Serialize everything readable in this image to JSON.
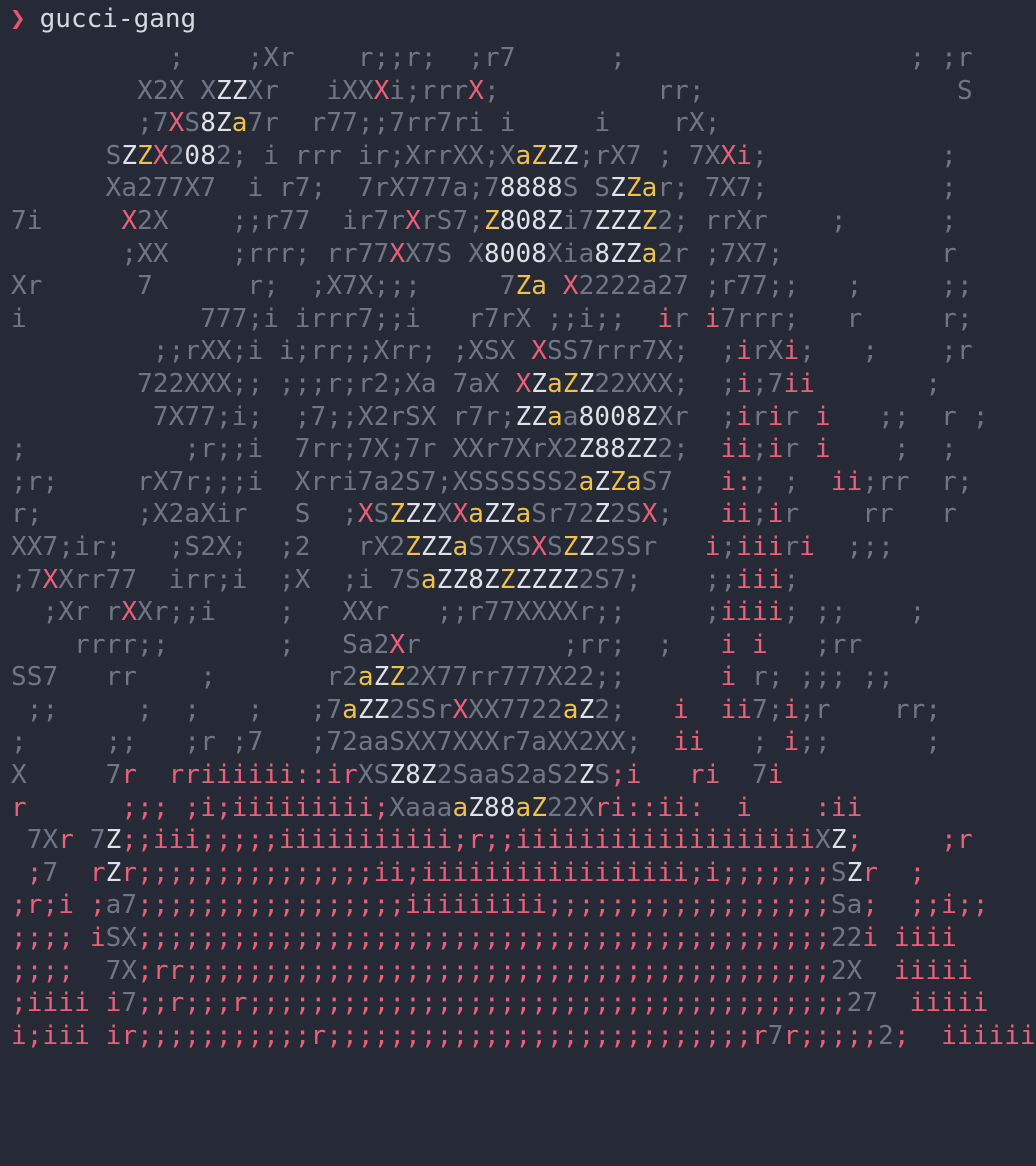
{
  "terminal": {
    "prompt_symbol": "❯",
    "command": "gucci-gang",
    "colors": {
      "background": "#252a36",
      "dim": "#6f7686",
      "red": "#ec5f79",
      "yellow": "#f0c24a",
      "white": "#dfe2e9"
    }
  },
  "art_rows": [
    "          ;    ;Xr    r;;r;  ;r7      ;                  ; ;r",
    "        X2X XZZXr   iXXXi;rrrX;          rr;                S",
    "        ;7XS8Za7r  r77;;7rr7ri i     i    rX;",
    "      SZZX2082; i rrr ir;XrrXX;XaZZZ;rX7 ; 7XXi;           ;",
    "      Xa277X7  i r7;  7rX777a;78888S SZZar; 7X7;           ;",
    "7i     X2X    ;;r77  ir7rXrS7;Z808Zi7ZZZZ2; rrXr    ;      ;",
    "       ;XX    ;rrr; rr77XX7S X8008Xia8ZZa2r ;7X7;          r",
    "Xr      7      r;  ;X7X;;;     7Za X2222a27 ;r77;;   ;     ;;",
    "i           777;i irrr7;;i   r7rX ;;i;;  ir i7rrr;   r     r;",
    "         ;;rXX;i i;rr;;Xrr; ;XSX XSS7rrr7X;  ;irXi;   ;    ;r",
    "        722XXX;; ;;;r;r2;Xa 7aX XZaZZ22XXX;  ;i;7ii       ;",
    "         7X77;i;  ;7;;X2rSX r7r;ZZaa8008ZXr  ;irir i   ;;  r ;",
    ";          ;r;;i  7rr;7X;7r XXr7XrX2Z88ZZ2;  ii;ir i    ;  ;",
    ";r;     rX7r;;;i  Xrri7a2S7;XSSSSSS2aZZaS7   i:; ;  ii;rr  r;",
    "r;      ;X2aXir   S  ;XSZZZXXaZZaSr72Z2SX;   ii;ir    rr   r",
    "XX7;ir;   ;S2X;  ;2   rX2ZZZaS7XSXSZZ2SSr   i;iiiri  ;;;",
    ";7XXrr77  irr;i  ;X  ;i 7SaZZ8ZZZZZZ2S7;    ;;iii;",
    "  ;Xr rXXr;;i    ;   XXr   ;;r77XXXXr;;     ;iiii; ;;    ;",
    "    rrrr;;       ;   Sa2Xr         ;rr;  ;   i i   ;rr",
    "SS7   rr    ;       r2aZZ2X77rr777X22;;      i r; ;;; ;;",
    " ;;     ;  ;   ;   ;7aZZ2SSrXXX7722aZ2;   i  ii7;i;r    rr;",
    ";     ;;   ;r ;7   ;72aaSXX7XXXr7aXX2XX;  ii   ; i;;      ;",
    "X     7r  rriiiiii::irXSZ8Z2SaaS2aS2ZS;i   ri  7i",
    "r      ;;; ;i;iiiiiiiii;XaaaaZ88aZ22Xri::ii:  i    :ii",
    " 7Xr 7Z;;iii;;;;;iiiiiiiiiii;r;;iiiiiiiiiiiiiiiiiiiXZ;     ;r",
    " ;7  rZr;;;;;;;;;;;;;;;ii;iiiiiiiiiiiiiiiii;i;;;;;;;SZr  ;",
    ";r;i ;a7;;;;;;;;;;;;;;;;;iiiiiiiii;;;;;;;;;;;;;;;;;;Sa;  ;;i;;",
    ";;;; iSX;;;;;;;;;;;;;;;;;;;;;;;;;;;;;;;;;;;;;;;;;;;;22i iiii",
    ";;;;  7X;rr;;;;;;;;;;;;;;;;;;;;;;;;;;;;;;;;;;;;;;;;;2X  iiiii",
    ";iiii i7;;r;;;r;;;;;;;;;;;;;;;;;;;;;;;;;;;;;;;;;;;;;;27  iiiii",
    "i;iii ir;;;;;;;;;;;r;;;;;;;;;;;;;;;;;;;;;;;;;;;r7r;;;;;2;  iiiiii"
  ]
}
